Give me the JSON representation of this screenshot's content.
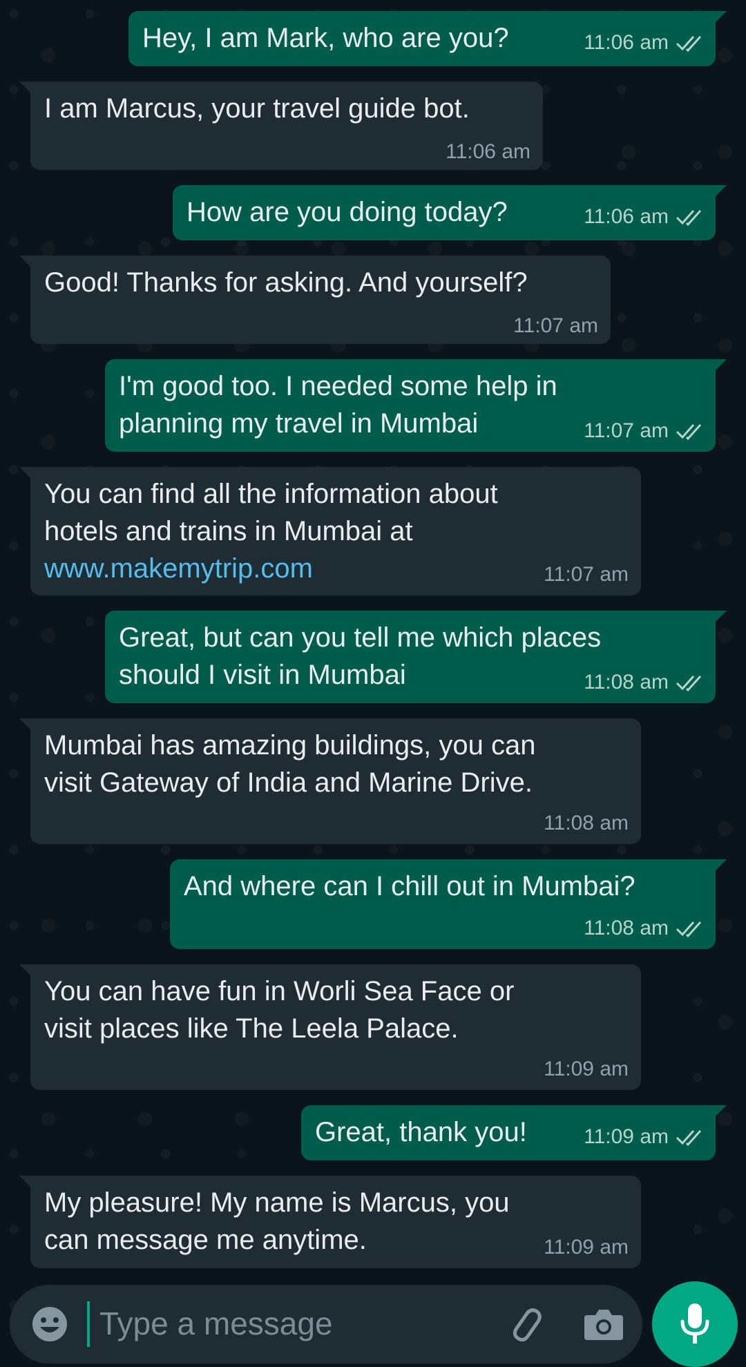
{
  "messages": [
    {
      "dir": "out",
      "text": "Hey, I am Mark, who are you?",
      "time": "11:06 am",
      "read": true
    },
    {
      "dir": "in",
      "text": "I am Marcus, your travel guide bot.",
      "time": "11:06 am"
    },
    {
      "dir": "out",
      "text": "How are you doing today?",
      "time": "11:06 am",
      "read": true
    },
    {
      "dir": "in",
      "text": "Good! Thanks for asking. And yourself?",
      "time": "11:07 am"
    },
    {
      "dir": "out",
      "text": "I'm good too. I needed some help in\nplanning my travel in Mumbai",
      "time": "11:07 am",
      "read": true
    },
    {
      "dir": "in",
      "text": "You can find all the information about\nhotels and trains in Mumbai at",
      "link": "www.makemytrip.com",
      "time": "11:07 am"
    },
    {
      "dir": "out",
      "text": "Great, but can you tell me which places\nshould I visit in Mumbai",
      "time": "11:08 am",
      "read": true
    },
    {
      "dir": "in",
      "text": "Mumbai has amazing buildings, you can\nvisit Gateway of India and Marine Drive.",
      "time": "11:08 am"
    },
    {
      "dir": "out",
      "text": "And where can I chill out in Mumbai?",
      "time": "11:08 am",
      "read": true
    },
    {
      "dir": "in",
      "text": "You can have fun in Worli Sea Face or\nvisit places like The Leela Palace.",
      "time": "11:09 am"
    },
    {
      "dir": "out",
      "text": "Great, thank you!",
      "time": "11:09 am",
      "read": true
    },
    {
      "dir": "in",
      "text": "My pleasure! My name is Marcus, you\ncan message me anytime.",
      "time": "11:09 am"
    }
  ],
  "composer": {
    "placeholder": "Type a message",
    "icons": [
      "emoji-icon",
      "attach-icon",
      "camera-icon",
      "mic-icon"
    ]
  },
  "colors": {
    "outgoing_bubble": "#005c4b",
    "incoming_bubble": "#202c33",
    "background": "#0b141a",
    "accent": "#00a884",
    "link": "#53bdeb"
  }
}
